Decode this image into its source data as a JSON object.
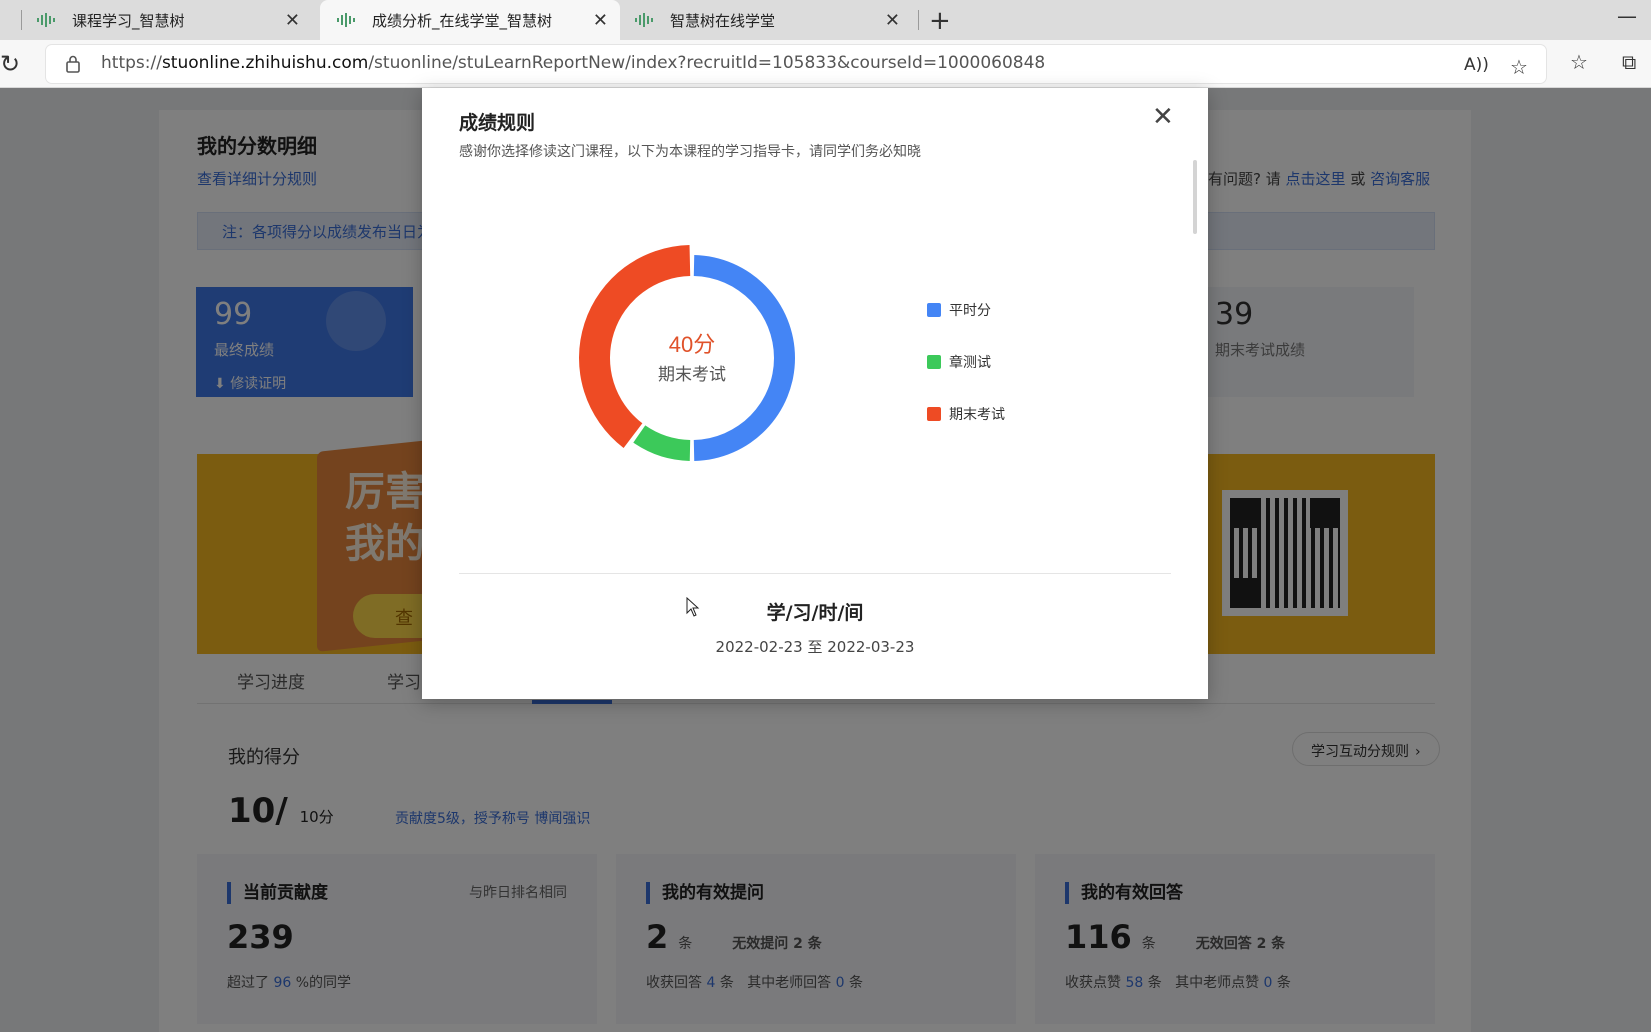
{
  "browser": {
    "tabs": [
      {
        "title": "课程学习_智慧树"
      },
      {
        "title": "成绩分析_在线学堂_智慧树"
      },
      {
        "title": "智慧树在线学堂"
      }
    ],
    "url_host": "stuonline.zhihuishu.com",
    "url_prefix": "https://",
    "url_path": "/stuonline/stuLearnReportNew/index?recruitId=105833&courseId=1000060848"
  },
  "page": {
    "section_title": "我的分数明细",
    "rule_link": "查看详细计分规则",
    "help_prefix": "有问题? 请",
    "help_link1": "点击这里",
    "help_or": "或",
    "help_link2": "咨询客服",
    "note": "注：各项得分以成绩发布当日为准",
    "final_score": "99",
    "final_score_label": "最终成绩",
    "cert_label": "修读证明",
    "exam_score": "39",
    "exam_score_label": "期末考试成绩",
    "banner_text_line1": "厉害了",
    "banner_text_line2": "我的证",
    "banner_button": "查",
    "tabs": [
      "学习进度",
      "学习"
    ],
    "my_score_label": "我的得分",
    "my_score_value": "10/",
    "my_score_total": "10分",
    "contrib_text": "贡献度5级，授予称号 博闻强识",
    "rules_button": "学习互动分规则",
    "cards": [
      {
        "title": "当前贡献度",
        "right_note": "与昨日排名相同",
        "big": "239",
        "sub_prefix": "超过了",
        "sub_value": "96",
        "sub_suffix": "%的同学"
      },
      {
        "title": "我的有效提问",
        "big": "2",
        "unit": "条",
        "side_label": "无效提问",
        "side_value": "2",
        "side_unit": "条",
        "sub_a_label": "收获回答",
        "sub_a_value": "4",
        "sub_a_unit": "条",
        "sub_b_label": "其中老师回答",
        "sub_b_value": "0",
        "sub_b_unit": "条"
      },
      {
        "title": "我的有效回答",
        "big": "116",
        "unit": "条",
        "side_label": "无效回答",
        "side_value": "2",
        "side_unit": "条",
        "sub_a_label": "收获点赞",
        "sub_a_value": "58",
        "sub_a_unit": "条",
        "sub_b_label": "其中老师点赞",
        "sub_b_value": "0",
        "sub_b_unit": "条"
      }
    ]
  },
  "modal": {
    "title": "成绩规则",
    "subtitle": "感谢你选择修读这门课程，以下为本课程的学习指导卡，请同学们务必知晓",
    "close_label": "✕",
    "donut_value": "40分",
    "donut_label": "期末考试",
    "period_title": "学/习/时/间",
    "period_range": "2022-02-23 至 2022-03-23"
  },
  "chart_data": {
    "type": "pie",
    "categories": [
      "平时分",
      "章测试",
      "期末考试"
    ],
    "values": [
      50,
      10,
      40
    ],
    "colors": [
      "#4485f5",
      "#3cc95a",
      "#ee4b24"
    ],
    "highlight": "期末考试",
    "legend_position": "right"
  },
  "colors": {
    "accent": "#3b6fd8",
    "overlay": "rgba(0,0,0,0.5)"
  }
}
